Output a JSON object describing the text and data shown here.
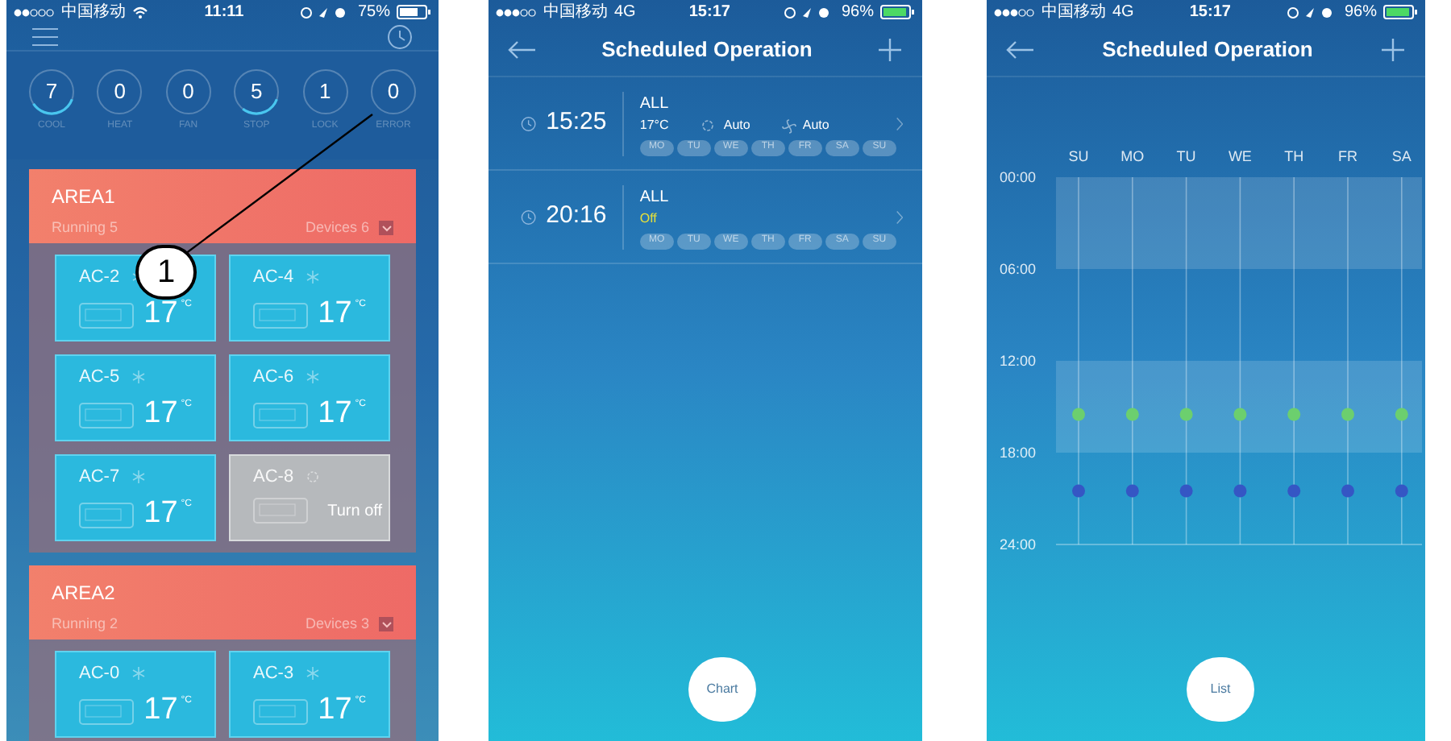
{
  "devices_screen": {
    "status_bar": {
      "carrier": "中国移动",
      "wifi": true,
      "time": "11:11",
      "battery": "75%"
    },
    "counters": [
      {
        "value": "7",
        "label": "COOL",
        "level": 0.35
      },
      {
        "value": "0",
        "label": "HEAT",
        "level": 0
      },
      {
        "value": "0",
        "label": "FAN",
        "level": 0
      },
      {
        "value": "5",
        "label": "STOP",
        "level": 0.3
      },
      {
        "value": "1",
        "label": "LOCK",
        "level": 0
      },
      {
        "value": "0",
        "label": "ERROR",
        "level": 0
      }
    ],
    "areas": [
      {
        "name": "AREA1",
        "running": "Running 5",
        "devices_count": "Devices 6",
        "devices": [
          {
            "name": "AC-2",
            "on": true,
            "temp": "17",
            "unit": "°C"
          },
          {
            "name": "AC-4",
            "on": true,
            "temp": "17",
            "unit": "°C"
          },
          {
            "name": "AC-5",
            "on": true,
            "temp": "17",
            "unit": "°C"
          },
          {
            "name": "AC-6",
            "on": true,
            "temp": "17",
            "unit": "°C"
          },
          {
            "name": "AC-7",
            "on": true,
            "temp": "17",
            "unit": "°C"
          },
          {
            "name": "AC-8",
            "on": false,
            "off_text": "Turn off"
          }
        ]
      },
      {
        "name": "AREA2",
        "running": "Running 2",
        "devices_count": "Devices 3",
        "devices": [
          {
            "name": "AC-0",
            "on": true,
            "temp": "17",
            "unit": "°C"
          },
          {
            "name": "AC-3",
            "on": true,
            "temp": "17",
            "unit": "°C"
          }
        ]
      }
    ]
  },
  "callout": {
    "label": "1"
  },
  "schedule_list_screen": {
    "status_bar": {
      "carrier": "中国移动",
      "network": "4G",
      "time": "15:17",
      "battery": "96%"
    },
    "title": "Scheduled Operation",
    "schedules": [
      {
        "time": "15:25",
        "target": "ALL",
        "kind": "on",
        "temp": "17°C",
        "mode": "Auto",
        "fan": "Auto",
        "days": [
          "MO",
          "TU",
          "WE",
          "TH",
          "FR",
          "SA",
          "SU"
        ]
      },
      {
        "time": "20:16",
        "target": "ALL",
        "kind": "off",
        "state": "Off",
        "days": [
          "MO",
          "TU",
          "WE",
          "TH",
          "FR",
          "SA",
          "SU"
        ]
      }
    ],
    "toggle_button": "Chart"
  },
  "schedule_chart_screen": {
    "status_bar": {
      "carrier": "中国移动",
      "network": "4G",
      "time": "15:17",
      "battery": "96%"
    },
    "title": "Scheduled Operation",
    "chart_data": {
      "type": "scatter",
      "categories": [
        "SU",
        "MO",
        "TU",
        "WE",
        "TH",
        "FR",
        "SA"
      ],
      "ylim": [
        24,
        0
      ],
      "grid": true,
      "yticks": [
        {
          "value": 0,
          "label": "00:00"
        },
        {
          "value": 6,
          "label": "06:00"
        },
        {
          "value": 12,
          "label": "12:00"
        },
        {
          "value": 18,
          "label": "18:00"
        },
        {
          "value": 24,
          "label": "24:00"
        }
      ],
      "series": [
        {
          "color": "#6ccf6e",
          "values": [
            15.5,
            15.5,
            15.5,
            15.5,
            15.5,
            15.5,
            15.5
          ]
        },
        {
          "color": "#3556c4",
          "values": [
            20.5,
            20.5,
            20.5,
            20.5,
            20.5,
            20.5,
            20.5
          ]
        }
      ]
    },
    "toggle_button": "List"
  }
}
